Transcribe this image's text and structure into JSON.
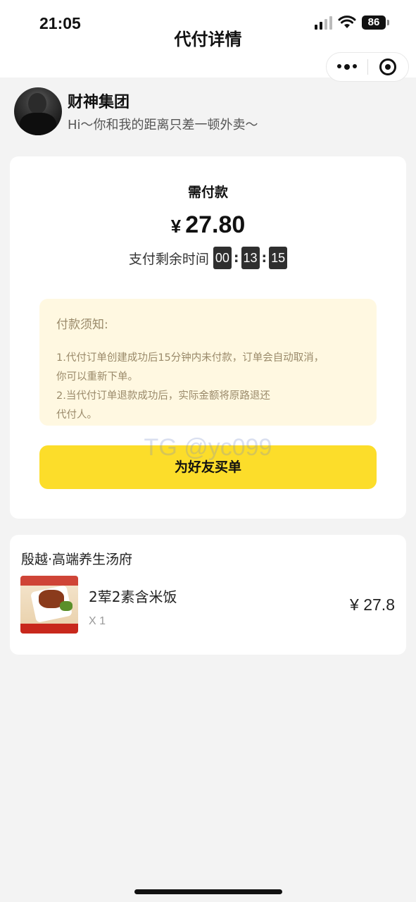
{
  "status_bar": {
    "time": "21:05",
    "battery": "86"
  },
  "nav": {
    "title": "代付详情"
  },
  "capsule": {
    "more_icon": "more-dots-icon",
    "close_icon": "target-circle-icon"
  },
  "profile": {
    "name": "财神集团",
    "greeting": "Hi～你和我的距离只差一顿外卖～"
  },
  "payment": {
    "label": "需付款",
    "currency": "¥",
    "amount": "27.80",
    "countdown_label": "支付剩余时间",
    "countdown": {
      "hours": "00",
      "minutes": "13",
      "seconds": "15"
    }
  },
  "notice": {
    "title": "付款须知:",
    "lines": [
      "1.代付订单创建成功后15分钟内未付款，订单会自动取消，",
      "你可以重新下单。",
      "2.当代付订单退款成功后，实际金额将原路退还",
      "代付人。"
    ]
  },
  "watermark": "TG @yc099",
  "pay_button_label": "为好友买单",
  "order": {
    "shop_name": "殷越·高端养生汤府",
    "item_name": "2荤2素含米饭",
    "item_qty": "X 1",
    "item_price": "¥ 27.8"
  },
  "colors": {
    "accent": "#fcdd2a",
    "notice_bg": "#fff8e1",
    "page_bg": "#f3f3f3"
  }
}
